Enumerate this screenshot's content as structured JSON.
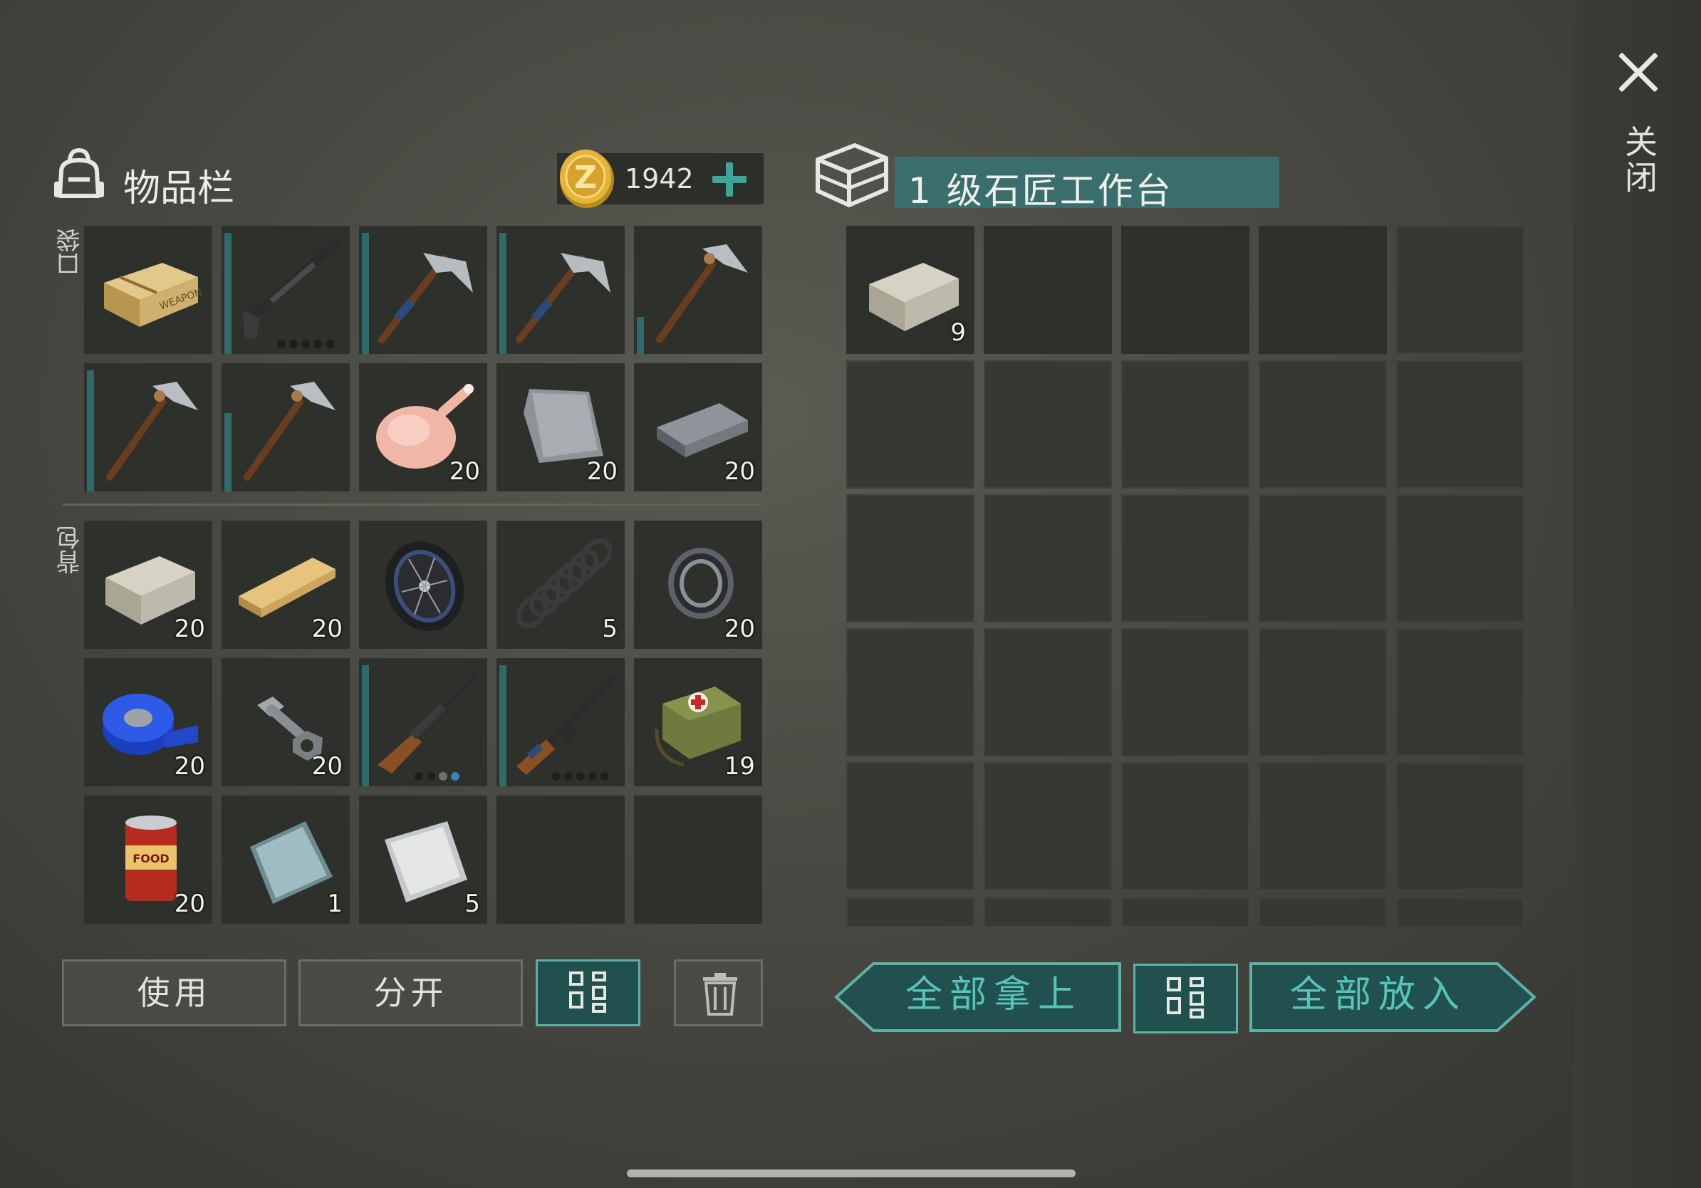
{
  "close": {
    "label": "关闭"
  },
  "inventory": {
    "title": "物品栏",
    "coins": "1942",
    "pocket_label": "口袋",
    "backpack_label": "背包",
    "pocket_counts": [
      "",
      "",
      "",
      "",
      "",
      "",
      "",
      "20",
      "20",
      "20"
    ],
    "backpack_counts": [
      "20",
      "20",
      "",
      "5",
      "20",
      "20",
      "20",
      "",
      "",
      "19",
      "20",
      "1",
      "5",
      "",
      ""
    ],
    "buttons": {
      "use": "使用",
      "split": "分开"
    }
  },
  "storage": {
    "title": "1 级石匠工作台",
    "first_count": "9",
    "buttons": {
      "take_all": "全部拿上",
      "put_all": "全部放入"
    }
  },
  "colors": {
    "accent": "#3fa59a",
    "teal_button": "#22504f",
    "title_box": "#3a6e6c"
  }
}
